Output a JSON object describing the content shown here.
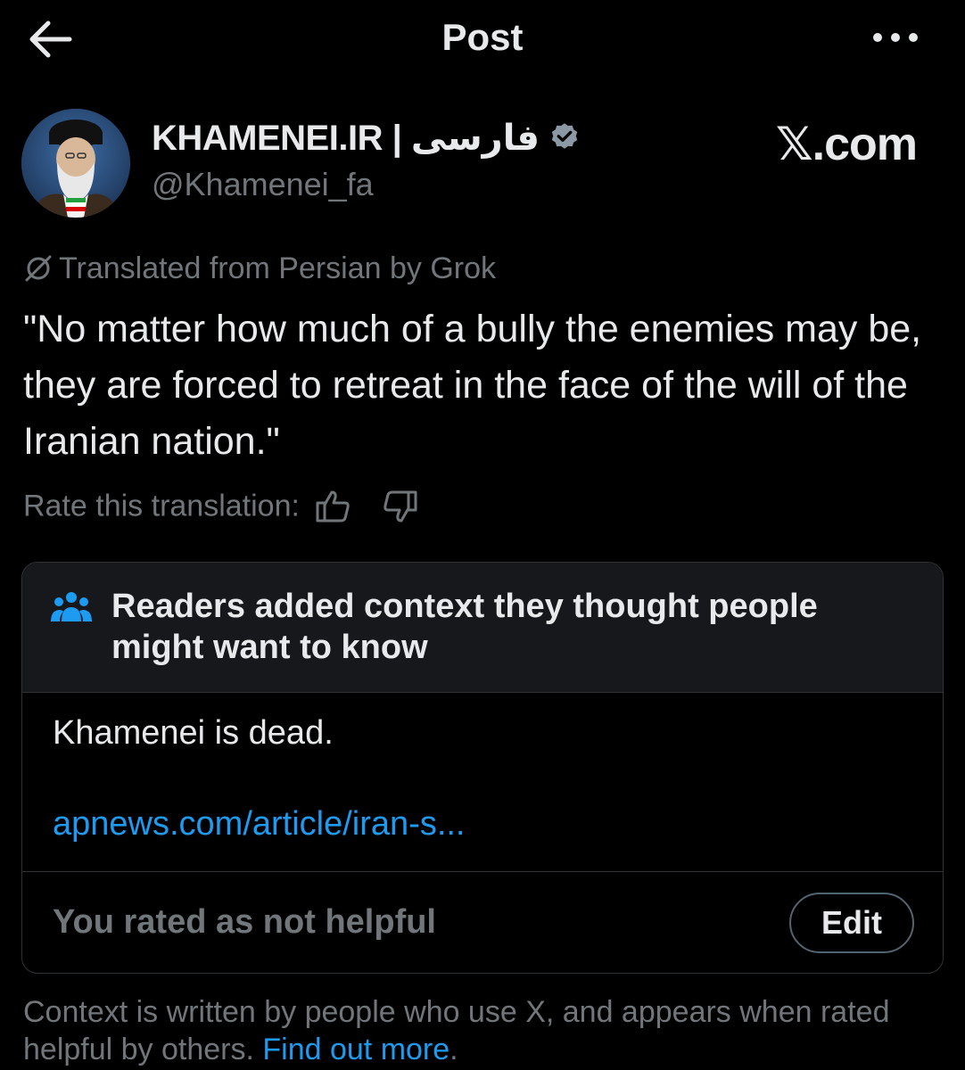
{
  "header": {
    "title": "Post",
    "back_icon": "arrow-left-icon",
    "more_icon": "more-horizontal-icon"
  },
  "author": {
    "display_name": "KHAMENEI.IR | فارسی",
    "handle": "@Khamenei_fa",
    "verified": true,
    "verified_color": "#8b98a5"
  },
  "watermark": "𝕏.com",
  "translation": {
    "notice": "Translated from Persian by Grok",
    "rate_label": "Rate this translation:"
  },
  "tweet": {
    "text": "\"No matter how much of a bully the enemies may be, they are forced to retreat in the face of the will of the Iranian nation.\""
  },
  "community_note": {
    "heading": "Readers added context they thought people might want to know",
    "body": "Khamenei is dead.",
    "link": "apnews.com/article/iran-s...",
    "rating_status": "You rated as not helpful",
    "edit_label": "Edit"
  },
  "footer": {
    "text": "Context is written by people who use X, and appears when rated helpful by others.",
    "link": "Find out more",
    "end": "."
  },
  "colors": {
    "background": "#000000",
    "text_primary": "#e7e9ea",
    "text_secondary": "#71767b",
    "link": "#1d9bf0",
    "note_header_bg": "#16181c",
    "border": "#2f3336",
    "readers_icon": "#1d9bf0"
  }
}
